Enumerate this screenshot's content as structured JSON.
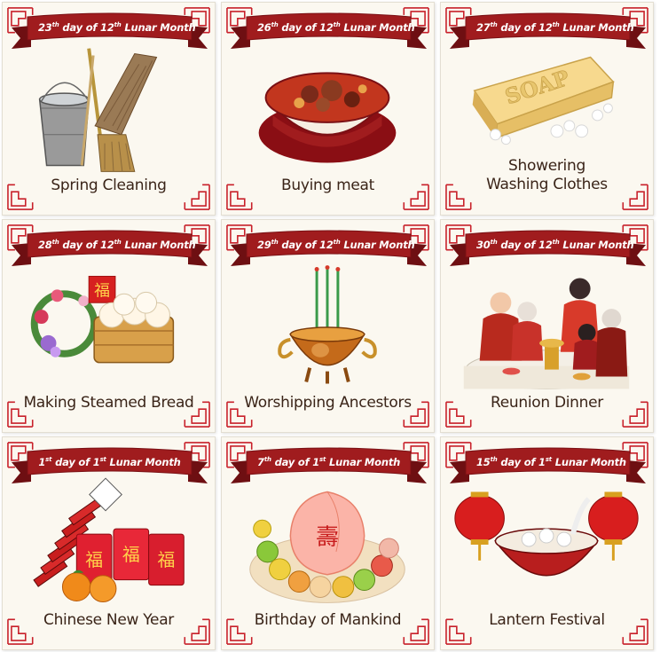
{
  "cards": [
    {
      "ord": "23",
      "ordSup": "th",
      "mon": "12",
      "monSup": "th",
      "line1": "Spring Cleaning",
      "line2": ""
    },
    {
      "ord": "26",
      "ordSup": "th",
      "mon": "12",
      "monSup": "th",
      "line1": "Buying meat",
      "line2": ""
    },
    {
      "ord": "27",
      "ordSup": "th",
      "mon": "12",
      "monSup": "th",
      "line1": "Showering",
      "line2": "Washing Clothes"
    },
    {
      "ord": "28",
      "ordSup": "th",
      "mon": "12",
      "monSup": "th",
      "line1": "Making Steamed Bread",
      "line2": ""
    },
    {
      "ord": "29",
      "ordSup": "th",
      "mon": "12",
      "monSup": "th",
      "line1": "Worshipping Ancestors",
      "line2": ""
    },
    {
      "ord": "30",
      "ordSup": "th",
      "mon": "12",
      "monSup": "th",
      "line1": "Reunion Dinner",
      "line2": ""
    },
    {
      "ord": "1",
      "ordSup": "st",
      "mon": "1",
      "monSup": "st",
      "line1": "Chinese New Year",
      "line2": ""
    },
    {
      "ord": "7",
      "ordSup": "th",
      "mon": "1",
      "monSup": "st",
      "line1": "Birthday of Mankind",
      "line2": ""
    },
    {
      "ord": "15",
      "ordSup": "th",
      "mon": "1",
      "monSup": "st",
      "line1": "Lantern Festival",
      "line2": ""
    }
  ],
  "banner_words": {
    "day_of": "day of",
    "lunar_month": "Lunar Month"
  },
  "icons": [
    "bucket-broom-icon",
    "meat-bowl-icon",
    "soap-icon",
    "steamed-buns-icon",
    "incense-burner-icon",
    "family-dinner-icon",
    "firecrackers-icon",
    "longevity-peach-icon",
    "tangyuan-lanterns-icon"
  ],
  "glyphs": {
    "fu": "福",
    "shou": "壽",
    "soap": "SOAP"
  },
  "colors": {
    "banner": "#a01c1e",
    "banner_dark": "#6e0f12",
    "frame": "#c8202a",
    "card_bg": "#fbf8f0",
    "caption": "#3a2418"
  }
}
